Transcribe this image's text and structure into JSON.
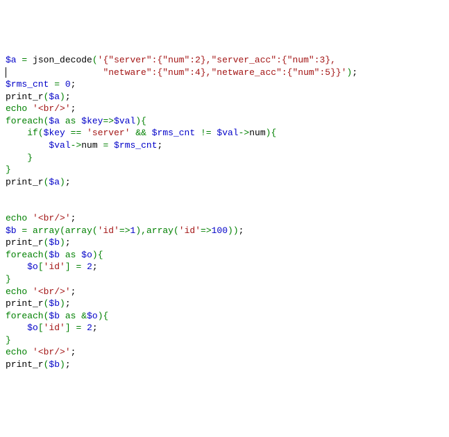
{
  "code": {
    "lines": [
      {
        "tokens": [
          {
            "cls": "blue",
            "text": "$a"
          },
          {
            "cls": "black",
            "text": " "
          },
          {
            "cls": "green",
            "text": "="
          },
          {
            "cls": "black",
            "text": " json_decode"
          },
          {
            "cls": "green",
            "text": "("
          },
          {
            "cls": "red",
            "text": "'{\"server\":{\"num\":2},\"server_acc\":{\"num\":3},"
          }
        ]
      },
      {
        "tokens": [
          {
            "cls": "black",
            "text": "                  "
          },
          {
            "cls": "red",
            "text": "\"netware\":{\"num\":4},\"netware_acc\":{\"num\":5}}'"
          },
          {
            "cls": "green",
            "text": ")"
          },
          {
            "cls": "black",
            "text": ";"
          }
        ],
        "caret_before": true
      },
      {
        "tokens": [
          {
            "cls": "blue",
            "text": "$rms_cnt"
          },
          {
            "cls": "black",
            "text": " "
          },
          {
            "cls": "green",
            "text": "="
          },
          {
            "cls": "black",
            "text": " "
          },
          {
            "cls": "blue",
            "text": "0"
          },
          {
            "cls": "black",
            "text": ";"
          }
        ]
      },
      {
        "tokens": [
          {
            "cls": "black",
            "text": "print_r"
          },
          {
            "cls": "green",
            "text": "("
          },
          {
            "cls": "blue",
            "text": "$a"
          },
          {
            "cls": "green",
            "text": ")"
          },
          {
            "cls": "black",
            "text": ";"
          }
        ]
      },
      {
        "tokens": [
          {
            "cls": "green",
            "text": "echo"
          },
          {
            "cls": "black",
            "text": " "
          },
          {
            "cls": "red",
            "text": "'<br/>'"
          },
          {
            "cls": "black",
            "text": ";"
          }
        ]
      },
      {
        "tokens": [
          {
            "cls": "green",
            "text": "foreach"
          },
          {
            "cls": "green",
            "text": "("
          },
          {
            "cls": "blue",
            "text": "$a"
          },
          {
            "cls": "black",
            "text": " "
          },
          {
            "cls": "green",
            "text": "as"
          },
          {
            "cls": "black",
            "text": " "
          },
          {
            "cls": "blue",
            "text": "$key"
          },
          {
            "cls": "green",
            "text": "=>"
          },
          {
            "cls": "blue",
            "text": "$val"
          },
          {
            "cls": "green",
            "text": ")"
          },
          {
            "cls": "green",
            "text": "{"
          }
        ]
      },
      {
        "tokens": [
          {
            "cls": "black",
            "text": "    "
          },
          {
            "cls": "green",
            "text": "if"
          },
          {
            "cls": "green",
            "text": "("
          },
          {
            "cls": "blue",
            "text": "$key"
          },
          {
            "cls": "black",
            "text": " "
          },
          {
            "cls": "green",
            "text": "=="
          },
          {
            "cls": "black",
            "text": " "
          },
          {
            "cls": "red",
            "text": "'server'"
          },
          {
            "cls": "black",
            "text": " "
          },
          {
            "cls": "green",
            "text": "&&"
          },
          {
            "cls": "black",
            "text": " "
          },
          {
            "cls": "blue",
            "text": "$rms_cnt"
          },
          {
            "cls": "black",
            "text": " "
          },
          {
            "cls": "green",
            "text": "!="
          },
          {
            "cls": "black",
            "text": " "
          },
          {
            "cls": "blue",
            "text": "$val"
          },
          {
            "cls": "green",
            "text": "->"
          },
          {
            "cls": "black",
            "text": "num"
          },
          {
            "cls": "green",
            "text": ")"
          },
          {
            "cls": "green",
            "text": "{"
          }
        ]
      },
      {
        "tokens": [
          {
            "cls": "black",
            "text": "        "
          },
          {
            "cls": "blue",
            "text": "$val"
          },
          {
            "cls": "green",
            "text": "->"
          },
          {
            "cls": "black",
            "text": "num "
          },
          {
            "cls": "green",
            "text": "="
          },
          {
            "cls": "black",
            "text": " "
          },
          {
            "cls": "blue",
            "text": "$rms_cnt"
          },
          {
            "cls": "black",
            "text": ";"
          }
        ]
      },
      {
        "tokens": [
          {
            "cls": "black",
            "text": "    "
          },
          {
            "cls": "green",
            "text": "}"
          }
        ]
      },
      {
        "tokens": [
          {
            "cls": "green",
            "text": "}"
          }
        ]
      },
      {
        "tokens": [
          {
            "cls": "black",
            "text": "print_r"
          },
          {
            "cls": "green",
            "text": "("
          },
          {
            "cls": "blue",
            "text": "$a"
          },
          {
            "cls": "green",
            "text": ")"
          },
          {
            "cls": "black",
            "text": ";"
          }
        ]
      },
      {
        "tokens": []
      },
      {
        "tokens": []
      },
      {
        "tokens": [
          {
            "cls": "green",
            "text": "echo"
          },
          {
            "cls": "black",
            "text": " "
          },
          {
            "cls": "red",
            "text": "'<br/>'"
          },
          {
            "cls": "black",
            "text": ";"
          }
        ]
      },
      {
        "tokens": [
          {
            "cls": "blue",
            "text": "$b"
          },
          {
            "cls": "black",
            "text": " "
          },
          {
            "cls": "green",
            "text": "="
          },
          {
            "cls": "black",
            "text": " "
          },
          {
            "cls": "green",
            "text": "array"
          },
          {
            "cls": "green",
            "text": "("
          },
          {
            "cls": "green",
            "text": "array"
          },
          {
            "cls": "green",
            "text": "("
          },
          {
            "cls": "red",
            "text": "'id'"
          },
          {
            "cls": "green",
            "text": "=>"
          },
          {
            "cls": "blue",
            "text": "1"
          },
          {
            "cls": "green",
            "text": ")"
          },
          {
            "cls": "green",
            "text": ","
          },
          {
            "cls": "green",
            "text": "array"
          },
          {
            "cls": "green",
            "text": "("
          },
          {
            "cls": "red",
            "text": "'id'"
          },
          {
            "cls": "green",
            "text": "=>"
          },
          {
            "cls": "blue",
            "text": "100"
          },
          {
            "cls": "green",
            "text": ")"
          },
          {
            "cls": "green",
            "text": ")"
          },
          {
            "cls": "black",
            "text": ";"
          }
        ]
      },
      {
        "tokens": [
          {
            "cls": "black",
            "text": "print_r"
          },
          {
            "cls": "green",
            "text": "("
          },
          {
            "cls": "blue",
            "text": "$b"
          },
          {
            "cls": "green",
            "text": ")"
          },
          {
            "cls": "black",
            "text": ";"
          }
        ]
      },
      {
        "tokens": [
          {
            "cls": "green",
            "text": "foreach"
          },
          {
            "cls": "green",
            "text": "("
          },
          {
            "cls": "blue",
            "text": "$b"
          },
          {
            "cls": "black",
            "text": " "
          },
          {
            "cls": "green",
            "text": "as"
          },
          {
            "cls": "black",
            "text": " "
          },
          {
            "cls": "blue",
            "text": "$o"
          },
          {
            "cls": "green",
            "text": ")"
          },
          {
            "cls": "green",
            "text": "{"
          }
        ]
      },
      {
        "tokens": [
          {
            "cls": "black",
            "text": "    "
          },
          {
            "cls": "blue",
            "text": "$o"
          },
          {
            "cls": "green",
            "text": "["
          },
          {
            "cls": "red",
            "text": "'id'"
          },
          {
            "cls": "green",
            "text": "]"
          },
          {
            "cls": "black",
            "text": " "
          },
          {
            "cls": "green",
            "text": "="
          },
          {
            "cls": "black",
            "text": " "
          },
          {
            "cls": "blue",
            "text": "2"
          },
          {
            "cls": "black",
            "text": ";"
          }
        ]
      },
      {
        "tokens": [
          {
            "cls": "green",
            "text": "}"
          }
        ]
      },
      {
        "tokens": [
          {
            "cls": "green",
            "text": "echo"
          },
          {
            "cls": "black",
            "text": " "
          },
          {
            "cls": "red",
            "text": "'<br/>'"
          },
          {
            "cls": "black",
            "text": ";"
          }
        ]
      },
      {
        "tokens": [
          {
            "cls": "black",
            "text": "print_r"
          },
          {
            "cls": "green",
            "text": "("
          },
          {
            "cls": "blue",
            "text": "$b"
          },
          {
            "cls": "green",
            "text": ")"
          },
          {
            "cls": "black",
            "text": ";"
          }
        ]
      },
      {
        "tokens": [
          {
            "cls": "green",
            "text": "foreach"
          },
          {
            "cls": "green",
            "text": "("
          },
          {
            "cls": "blue",
            "text": "$b"
          },
          {
            "cls": "black",
            "text": " "
          },
          {
            "cls": "green",
            "text": "as"
          },
          {
            "cls": "black",
            "text": " "
          },
          {
            "cls": "green",
            "text": "&"
          },
          {
            "cls": "blue",
            "text": "$o"
          },
          {
            "cls": "green",
            "text": ")"
          },
          {
            "cls": "green",
            "text": "{"
          }
        ]
      },
      {
        "tokens": [
          {
            "cls": "black",
            "text": "    "
          },
          {
            "cls": "blue",
            "text": "$o"
          },
          {
            "cls": "green",
            "text": "["
          },
          {
            "cls": "red",
            "text": "'id'"
          },
          {
            "cls": "green",
            "text": "]"
          },
          {
            "cls": "black",
            "text": " "
          },
          {
            "cls": "green",
            "text": "="
          },
          {
            "cls": "black",
            "text": " "
          },
          {
            "cls": "blue",
            "text": "2"
          },
          {
            "cls": "black",
            "text": ";"
          }
        ]
      },
      {
        "tokens": [
          {
            "cls": "green",
            "text": "}"
          }
        ]
      },
      {
        "tokens": [
          {
            "cls": "green",
            "text": "echo"
          },
          {
            "cls": "black",
            "text": " "
          },
          {
            "cls": "red",
            "text": "'<br/>'"
          },
          {
            "cls": "black",
            "text": ";"
          }
        ]
      },
      {
        "tokens": [
          {
            "cls": "black",
            "text": "print_r"
          },
          {
            "cls": "green",
            "text": "("
          },
          {
            "cls": "blue",
            "text": "$b"
          },
          {
            "cls": "green",
            "text": ")"
          },
          {
            "cls": "black",
            "text": ";"
          }
        ]
      }
    ]
  }
}
